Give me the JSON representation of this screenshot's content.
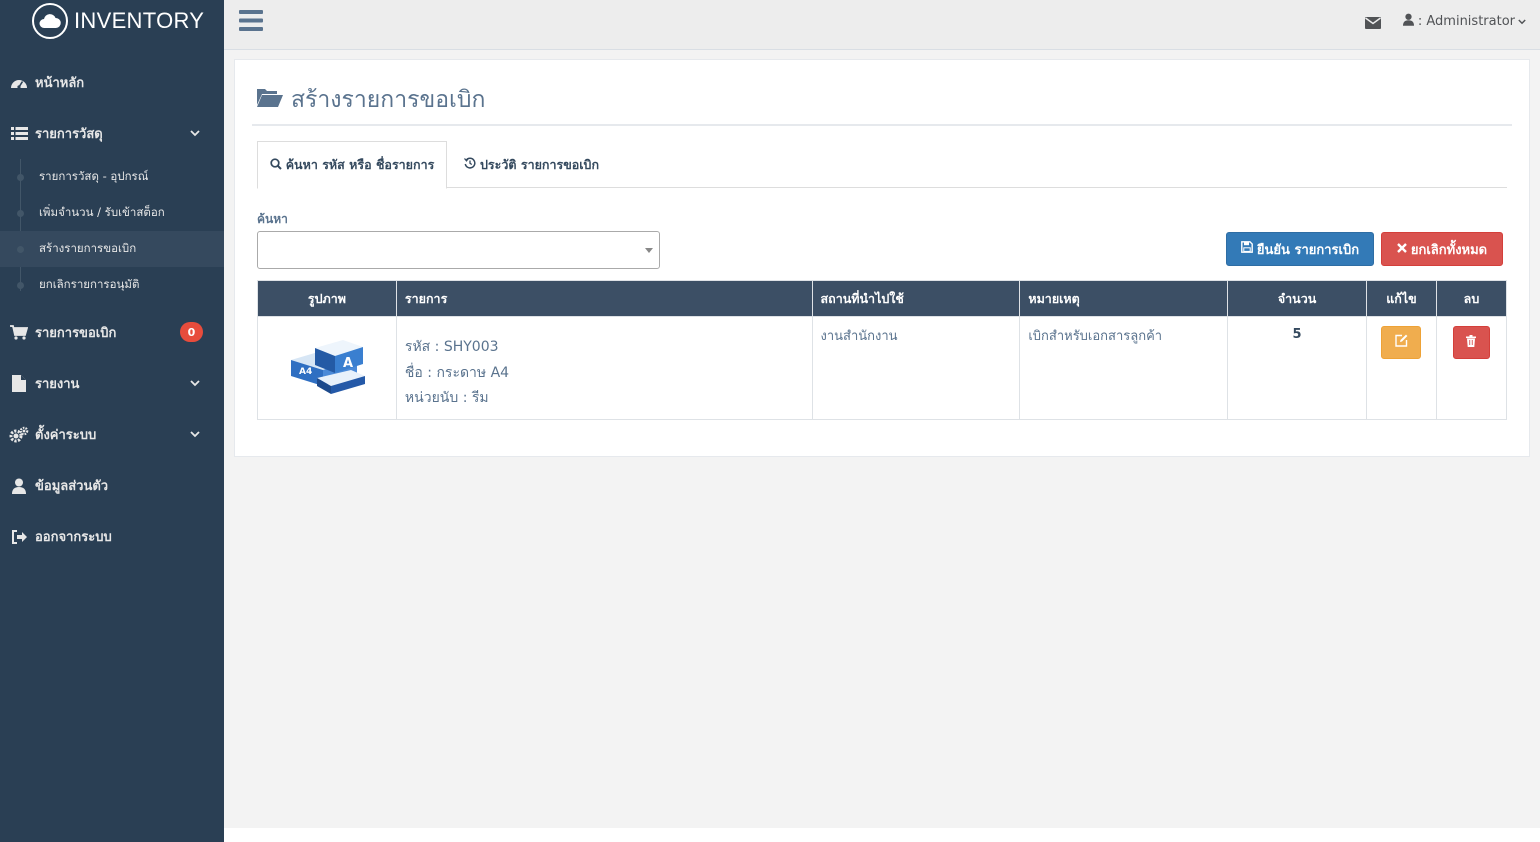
{
  "brand": {
    "title": "INVENTORY",
    "icon": "cloud-icon"
  },
  "sidebar": {
    "items": [
      {
        "label": "หน้าหลัก",
        "icon": "dashboard-icon"
      },
      {
        "label": "รายการวัสดุ",
        "icon": "list-icon"
      },
      {
        "label": "รายการขอเบิก",
        "icon": "cart-icon",
        "badge": "0"
      },
      {
        "label": "รายงาน",
        "icon": "file-icon"
      },
      {
        "label": "ตั้งค่าระบบ",
        "icon": "gears-icon"
      },
      {
        "label": "ข้อมูลส่วนตัว",
        "icon": "user-icon"
      },
      {
        "label": "ออกจากระบบ",
        "icon": "signout-icon"
      }
    ],
    "submenu": [
      {
        "label": "รายการวัสดุ - อุปกรณ์"
      },
      {
        "label": "เพิ่มจำนวน / รับเข้าสต็อก"
      },
      {
        "label": "สร้างรายการขอเบิก"
      },
      {
        "label": "ยกเลิกรายการอนุมัติ"
      }
    ]
  },
  "topbar": {
    "user_label": ": Administrator"
  },
  "page": {
    "title": "สร้างรายการขอเบิก",
    "tabs": [
      {
        "label": "ค้นหา รหัส หรือ ชื่อรายการ"
      },
      {
        "label": "ประวัติ รายการขอเบิก"
      }
    ],
    "search_label": "ค้นหา",
    "confirm_button": "ยืนยัน รายการเบิก",
    "cancel_all_button": "ยกเลิกทั้งหมด"
  },
  "table": {
    "headers": [
      "รูปภาพ",
      "รายการ",
      "สถานที่นำไปใช้",
      "หมายเหตุ",
      "จำนวน",
      "แก้ไข",
      "ลบ"
    ],
    "rows": [
      {
        "code": "รหัส : SHY003",
        "name": "ชื่อ : กระดาษ A4",
        "unit": "หน่วยนับ : รีม",
        "location": "งานสำนักงาน",
        "note": "เบิกสำหรับเอกสารลูกค้า",
        "qty": "5"
      }
    ]
  },
  "colors": {
    "sidebar_bg": "#2a3f54",
    "header_bg": "#3c4f65",
    "primary": "#337ab7",
    "danger": "#d9534f",
    "warning": "#f0ad4e",
    "badge": "#e74c3c"
  }
}
